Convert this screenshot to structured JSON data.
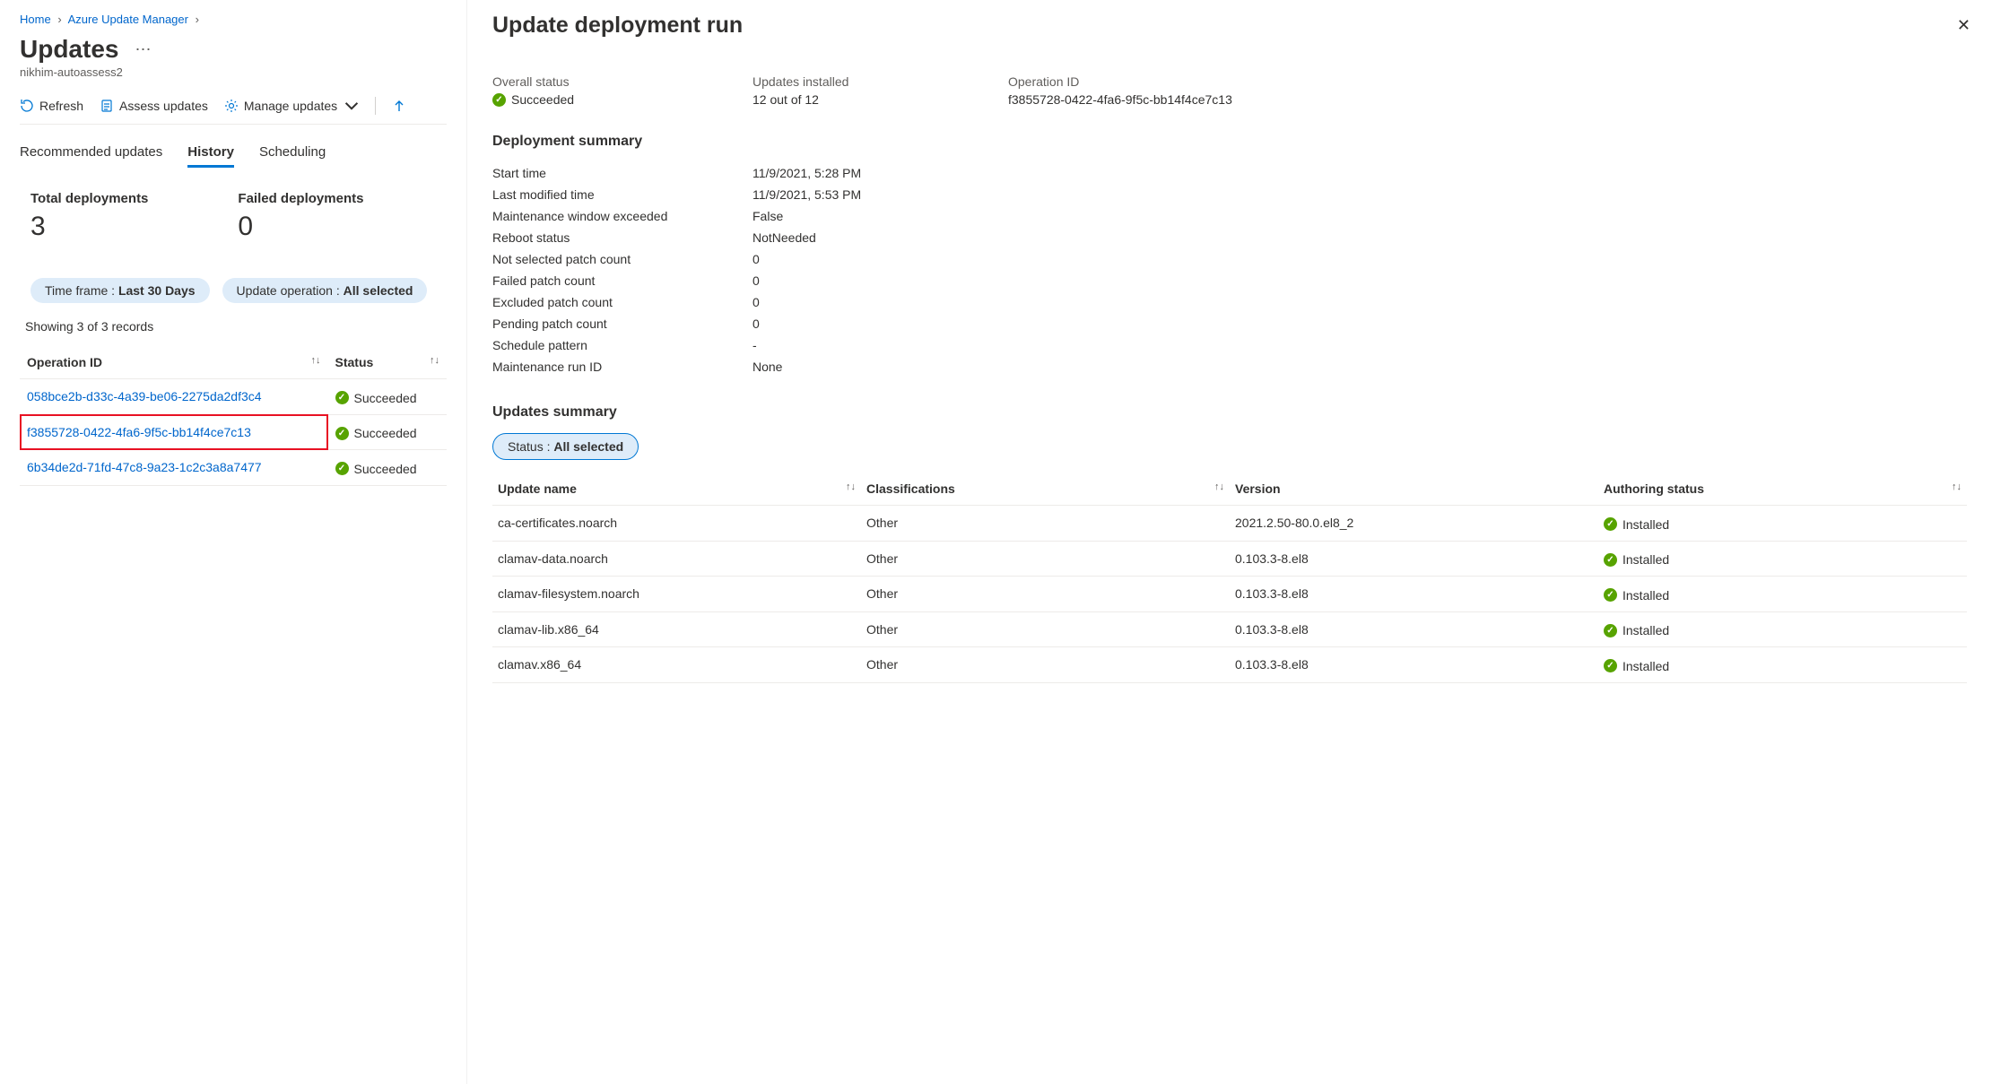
{
  "breadcrumb": {
    "home": "Home",
    "mid": "Azure Update Manager"
  },
  "page": {
    "title": "Updates",
    "subtitle": "nikhim-autoassess2"
  },
  "toolbar": {
    "refresh": "Refresh",
    "assess": "Assess updates",
    "manage": "Manage updates"
  },
  "tabs": {
    "recommended": "Recommended updates",
    "history": "History",
    "scheduling": "Scheduling"
  },
  "stats": {
    "total_label": "Total deployments",
    "total_value": "3",
    "failed_label": "Failed deployments",
    "failed_value": "0"
  },
  "filters": {
    "time_prefix": "Time frame : ",
    "time_value": "Last 30 Days",
    "op_prefix": "Update operation : ",
    "op_value": "All selected"
  },
  "records_info": "Showing 3 of 3 records",
  "history_table": {
    "col_operation": "Operation ID",
    "col_status": "Status",
    "rows": [
      {
        "id": "058bce2b-d33c-4a39-be06-2275da2df3c4",
        "status": "Succeeded",
        "highlight": false
      },
      {
        "id": "f3855728-0422-4fa6-9f5c-bb14f4ce7c13",
        "status": "Succeeded",
        "highlight": true
      },
      {
        "id": "6b34de2d-71fd-47c8-9a23-1c2c3a8a7477",
        "status": "Succeeded",
        "highlight": false
      }
    ]
  },
  "panel": {
    "title": "Update deployment run",
    "overview": {
      "overall_label": "Overall status",
      "overall_value": "Succeeded",
      "installed_label": "Updates installed",
      "installed_value": "12 out of 12",
      "opid_label": "Operation ID",
      "opid_value": "f3855728-0422-4fa6-9f5c-bb14f4ce7c13"
    },
    "summary_title": "Deployment summary",
    "summary": [
      {
        "k": "Start time",
        "v": "11/9/2021, 5:28 PM"
      },
      {
        "k": "Last modified time",
        "v": "11/9/2021, 5:53 PM"
      },
      {
        "k": "Maintenance window exceeded",
        "v": "False"
      },
      {
        "k": "Reboot status",
        "v": "NotNeeded"
      },
      {
        "k": "Not selected patch count",
        "v": "0"
      },
      {
        "k": "Failed patch count",
        "v": "0"
      },
      {
        "k": "Excluded patch count",
        "v": "0"
      },
      {
        "k": "Pending patch count",
        "v": "0"
      },
      {
        "k": "Schedule pattern",
        "v": "-"
      },
      {
        "k": "Maintenance run ID",
        "v": "None"
      }
    ],
    "updates_title": "Updates summary",
    "status_filter_prefix": "Status : ",
    "status_filter_value": "All selected",
    "updates_table": {
      "col_name": "Update name",
      "col_class": "Classifications",
      "col_version": "Version",
      "col_auth": "Authoring status",
      "rows": [
        {
          "name": "ca-certificates.noarch",
          "class": "Other",
          "version": "2021.2.50-80.0.el8_2",
          "auth": "Installed"
        },
        {
          "name": "clamav-data.noarch",
          "class": "Other",
          "version": "0.103.3-8.el8",
          "auth": "Installed"
        },
        {
          "name": "clamav-filesystem.noarch",
          "class": "Other",
          "version": "0.103.3-8.el8",
          "auth": "Installed"
        },
        {
          "name": "clamav-lib.x86_64",
          "class": "Other",
          "version": "0.103.3-8.el8",
          "auth": "Installed"
        },
        {
          "name": "clamav.x86_64",
          "class": "Other",
          "version": "0.103.3-8.el8",
          "auth": "Installed"
        }
      ]
    }
  }
}
